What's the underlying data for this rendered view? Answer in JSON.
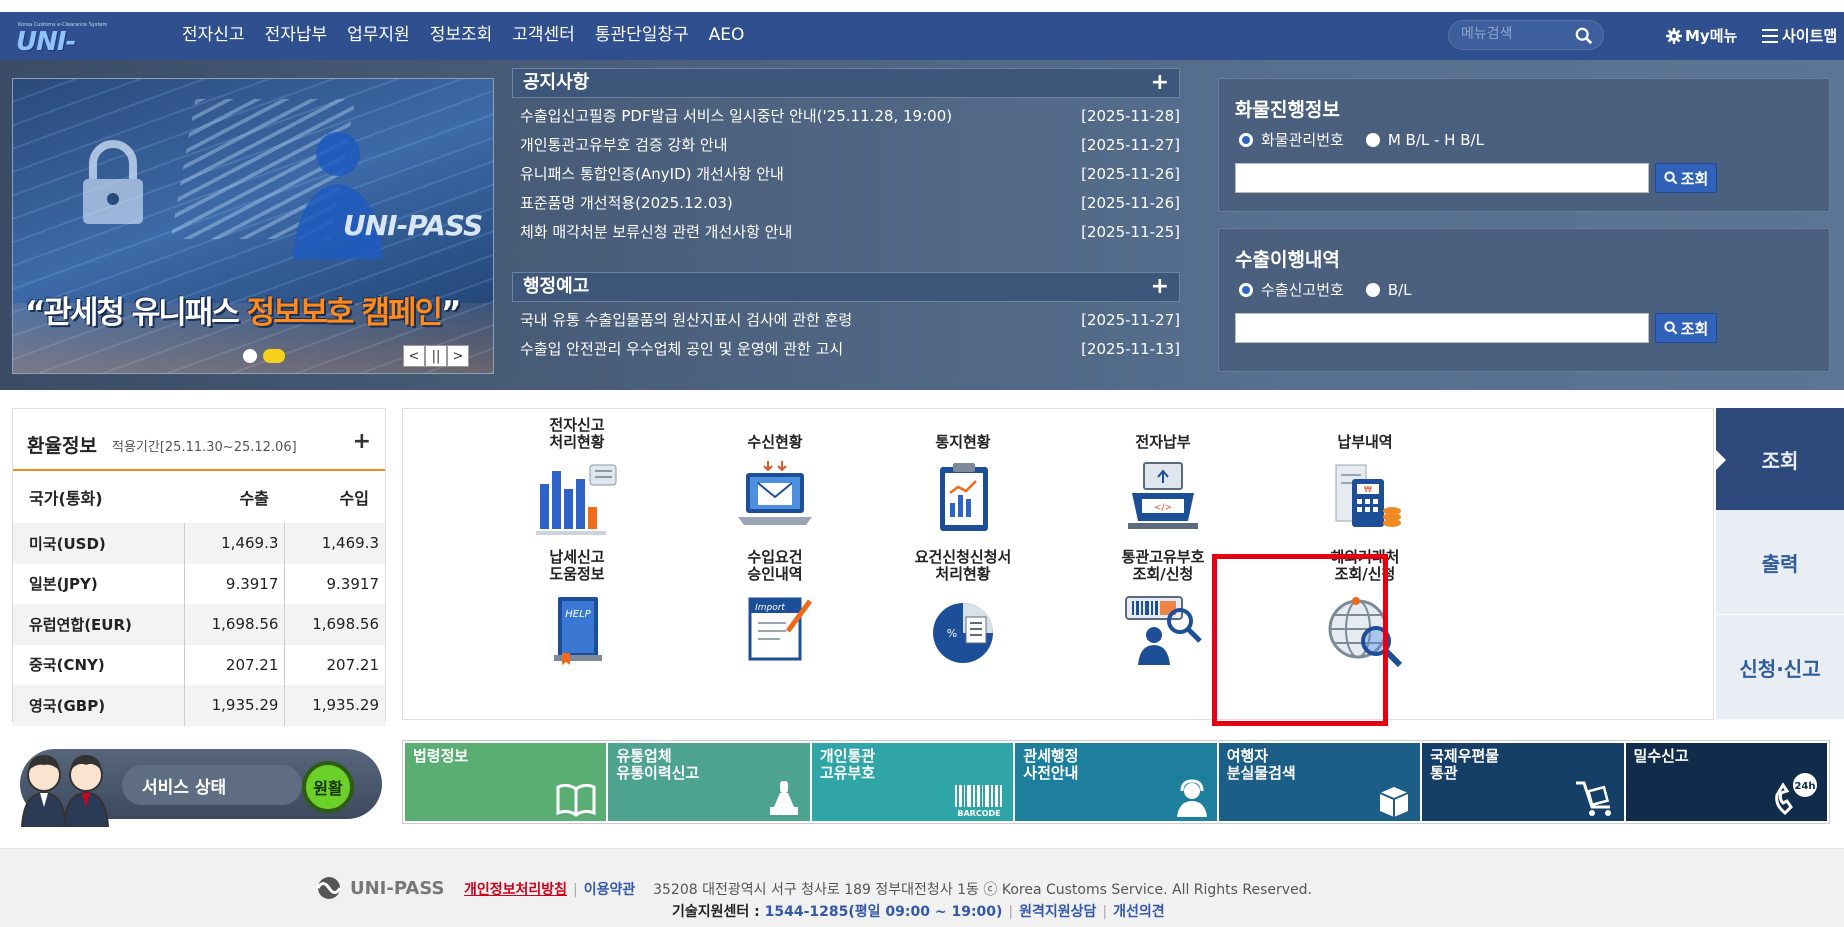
{
  "header": {
    "logo_small": "Korea Customs e-Clearance System",
    "logo": "UNI-PASS",
    "nav": [
      "전자신고",
      "전자납부",
      "업무지원",
      "정보조회",
      "고객센터",
      "통관단일창구",
      "AEO"
    ],
    "search_placeholder": "메뉴검색",
    "mymenu": "My메뉴",
    "sitemap": "사이트맵"
  },
  "banner": {
    "campaign_white_1": "“관세청 유니패스 ",
    "campaign_orange": "정보보호 캠페인",
    "campaign_white_2": "”",
    "brand": "UNI-PASS",
    "ctrl_prev": "<",
    "ctrl_pause": "||",
    "ctrl_next": ">"
  },
  "notices": {
    "title": "공지사항",
    "more": "+",
    "items": [
      {
        "text": "수출입신고필증 PDF발급 서비스 일시중단 안내('25.11.28, 19:00)",
        "date": "[2025-11-28]"
      },
      {
        "text": "개인통관고유부호 검증 강화 안내",
        "date": "[2025-11-27]"
      },
      {
        "text": "유니패스 통합인증(AnyID) 개선사항 안내",
        "date": "[2025-11-26]"
      },
      {
        "text": "표준품명 개선적용(2025.12.03)",
        "date": "[2025-11-26]"
      },
      {
        "text": "체화 매각처분 보류신청 관련 개선사항 안내",
        "date": "[2025-11-25]"
      }
    ]
  },
  "admin_notices": {
    "title": "행정예고",
    "more": "+",
    "items": [
      {
        "text": "국내 유통 수출입물품의 원산지표시 검사에 관한 훈령",
        "date": "[2025-11-27]"
      },
      {
        "text": "수출입 안전관리 우수업체 공인 및 운영에 관한 고시",
        "date": "[2025-11-13]"
      }
    ]
  },
  "cargo": {
    "title": "화물진행정보",
    "option1": "화물관리번호",
    "option2": "M B/L - H B/L",
    "button": "조회"
  },
  "export_history": {
    "title": "수출이행내역",
    "option1": "수출신고번호",
    "option2": "B/L",
    "button": "조회"
  },
  "exchange": {
    "title": "환율정보",
    "period": "적용기간[25.11.30~25.12.06]",
    "more": "+",
    "headers": [
      "국가(통화)",
      "수출",
      "수입"
    ],
    "rows": [
      {
        "country": "미국(USD)",
        "export": "1,469.3",
        "import": "1,469.3"
      },
      {
        "country": "일본(JPY)",
        "export": "9.3917",
        "import": "9.3917"
      },
      {
        "country": "유럽연합(EUR)",
        "export": "1,698.56",
        "import": "1,698.56"
      },
      {
        "country": "중국(CNY)",
        "export": "207.21",
        "import": "207.21"
      },
      {
        "country": "영국(GBP)",
        "export": "1,935.29",
        "import": "1,935.29"
      }
    ]
  },
  "quick": {
    "items": [
      {
        "line1": "전자신고",
        "line2": "처리현황",
        "icon": "bar-chart-icon"
      },
      {
        "line1": "수신현황",
        "line2": "",
        "icon": "laptop-mail-icon"
      },
      {
        "line1": "통지현황",
        "line2": "",
        "icon": "report-board-icon"
      },
      {
        "line1": "전자납부",
        "line2": "",
        "icon": "payment-machine-icon"
      },
      {
        "line1": "납부내역",
        "line2": "",
        "icon": "receipt-calculator-icon"
      },
      {
        "line1": "납세신고",
        "line2": "도움정보",
        "icon": "help-book-icon"
      },
      {
        "line1": "수입요건",
        "line2": "승인내역",
        "icon": "import-document-icon"
      },
      {
        "line1": "요건신청신청서",
        "line2": "처리현황",
        "icon": "percent-chart-icon"
      },
      {
        "line1": "통관고유부호",
        "line2": "조회/신청",
        "icon": "barcode-person-search-icon"
      },
      {
        "line1": "해외거래처",
        "line2": "조회/신청",
        "icon": "globe-search-icon"
      }
    ]
  },
  "tabs": [
    "조회",
    "출력",
    "신청·신고"
  ],
  "status": {
    "label": "서비스 상태",
    "value": "원활"
  },
  "tiles": [
    {
      "line1": "법령정보",
      "line2": "",
      "color": "#5aae74",
      "icon": "book-icon"
    },
    {
      "line1": "유통업체",
      "line2": "유통이력신고",
      "color": "#4da38f",
      "icon": "stamp-icon"
    },
    {
      "line1": "개인통관",
      "line2": "고유부호",
      "color": "#2fa5a8",
      "icon": "barcode-icon",
      "icon_text": "BARCODE"
    },
    {
      "line1": "관세행정",
      "line2": "사전안내",
      "color": "#1d7f9c",
      "icon": "operator-icon"
    },
    {
      "line1": "여행자",
      "line2": "분실물검색",
      "color": "#1c5e86",
      "icon": "box-icon"
    },
    {
      "line1": "국제우편물",
      "line2": "통관",
      "color": "#163f67",
      "icon": "cart-icon"
    },
    {
      "line1": "밀수신고",
      "line2": "",
      "color": "#112b4a",
      "icon": "phone-24h-icon",
      "icon_text": "24h"
    }
  ],
  "footer": {
    "logo": "UNI-PASS",
    "privacy": "개인정보처리방침",
    "terms": "이용약관",
    "address": "35208 대전광역시 서구 청사로 189 정부대전청사 1동 ⓒ Korea Customs Service. All Rights Reserved.",
    "support_label": "기술지원센터 : ",
    "support_phone": "1544-1285(평일 09:00 ~ 19:00)",
    "remote": "원격지원상담",
    "improve": "개선의견"
  }
}
